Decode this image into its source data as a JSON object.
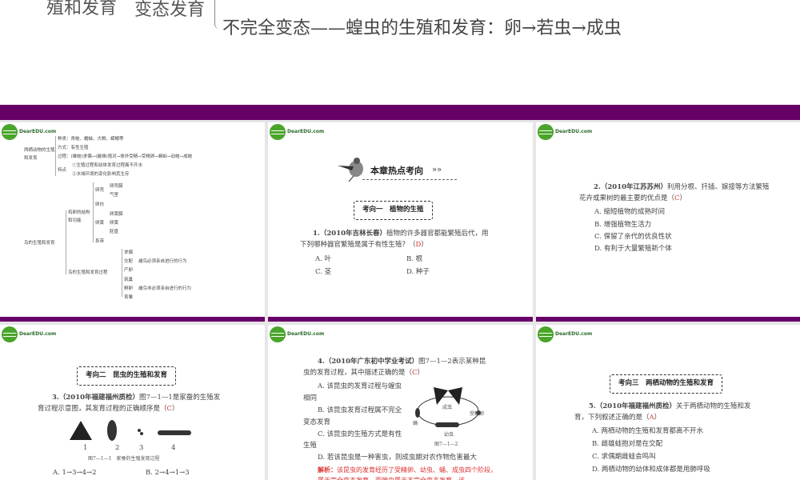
{
  "top_slide": {
    "left_text": "殖和发育",
    "mid_text": "变态发育",
    "line": "不完全变态——蝗虫的生殖和发育：卵→若虫→成虫"
  },
  "logo": {
    "text": "DearEDU.com"
  },
  "slides": [
    {
      "amphibian": {
        "title": "两栖动物的生殖和发育",
        "kinds": "种类：青蛙、蟾蜍、大鲵、蝾螈等",
        "method": "方式：有性生殖",
        "process": "过程：(雄蛙)求偶→(雌雄)抱对→体外受精→受精卵→蝌蚪→幼蛙→成蛙",
        "feature_label": "特点",
        "f1": "①生殖过程和幼体发育过程离不开水",
        "f2": "②水域环境的变化影响其生存"
      },
      "bird": {
        "title": "鸟的生殖和发育",
        "egg": "鸡卵的结构和功能",
        "shell": "卵壳",
        "shell_membrane": "卵壳膜",
        "air": "气室",
        "white": "卵白",
        "yolk": "卵黄",
        "yolk_membrane": "卵黄膜",
        "yolk2": "卵黄",
        "disc": "胚盘",
        "chalaza": "系带",
        "process": "鸟的生殖和发育过程",
        "s1": "求偶",
        "s2": "交配",
        "s3": "产卵",
        "s4": "筑巢",
        "s5": "孵卵",
        "s6": "育雏",
        "must": "雌鸟必须亲自进行的行为",
        "notmust": "雌鸟非必须亲自进行的行为"
      }
    },
    {
      "banner": "本章热点考向",
      "section": "考向一　植物的生殖",
      "q_src": "1.（2010年吉林长春）",
      "q": "植物的许多器官都能繁殖后代，用下列哪种器官繁殖是属于有性生殖？（",
      "ans": "D",
      "close": "）",
      "opts": [
        "A. 叶",
        "B. 根",
        "C. 茎",
        "D. 种子"
      ]
    },
    {
      "q_src": "2.（2010年江苏苏州）",
      "q": "利用分根、扦插、嫁接等方法繁殖花卉或果树的最主要的优点是（",
      "ans": "C",
      "close": "）",
      "opts": [
        "A. 缩短植物的成熟时间",
        "B. 增强植物生活力",
        "C. 保留了亲代的优良性状",
        "D. 有利于大量繁殖新个体"
      ]
    },
    {
      "section": "考向二　昆虫的生殖和发育",
      "q_src": "3.（2010年福建福州质检）",
      "q": "图7—1—1是家蚕的生殖发育过程示意图，其发育过程的正确顺序是（",
      "ans": "C",
      "close": "）",
      "fig_nums": [
        "1",
        "2",
        "3",
        "4"
      ],
      "fig_caption": "图7—1—1　家蚕的生殖发育过程",
      "opts": [
        "A. 1→3→4→2",
        "B. 2→4→1→3"
      ]
    },
    {
      "q_src": "4.（2010年广东初中学业考试）",
      "q": "图7—1—2表示某种昆虫的发育过程，其中描述正确的是（",
      "ans": "C",
      "close": "）",
      "opts": [
        "A. 该昆虫的发育过程与蝗虫相同",
        "B. 该昆虫发育过程属不完全变态发育",
        "C. 该昆虫的生殖方式是有性生殖",
        "D. 若该昆虫是一种害虫，则成虫期对农作物危害最大"
      ],
      "fig_labels": {
        "adult": "成虫",
        "egg": "受精卵",
        "pupa": "蛹",
        "larva": "幼虫"
      },
      "fig_caption": "图7—1—2",
      "analysis_label": "解析：",
      "analysis": "该昆虫的发育经历了受精卵、幼虫、蛹、成虫四个阶段，属于完全变态发育，而蝗虫属于不完全变态发育，该"
    },
    {
      "section": "考向三　两栖动物的生殖和发育",
      "q_src": "5.（2010年福建福州质检）",
      "q": "关于两栖动物的生殖和发育，下列叙述正确的是（",
      "ans": "A",
      "close": "）",
      "opts": [
        "A. 两栖动物的生殖和发育都离不开水",
        "B. 雌雄蛙抱对是在交配",
        "C. 求偶期雌蛙会鸣叫",
        "D. 两栖动物的幼体和成体都是用肺呼吸"
      ]
    }
  ],
  "colors": {
    "band": "#660066",
    "answer": "#dd3333",
    "logo": "#4aa52a"
  }
}
